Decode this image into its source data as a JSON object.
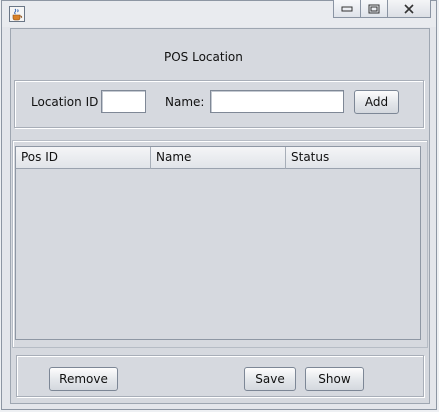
{
  "window": {
    "title": ""
  },
  "header": {
    "title": "POS Location"
  },
  "form": {
    "location_id_label": "Location ID",
    "location_id_value": "",
    "name_label": "Name:",
    "name_value": "",
    "add_label": "Add"
  },
  "table": {
    "columns": [
      "Pos ID",
      "Name",
      "Status"
    ],
    "rows": []
  },
  "footer": {
    "remove_label": "Remove",
    "save_label": "Save",
    "show_label": "Show"
  },
  "icons": {
    "app": "java-cup-icon",
    "minimize": "minimize-icon",
    "maximize": "maximize-icon",
    "close": "close-icon"
  }
}
